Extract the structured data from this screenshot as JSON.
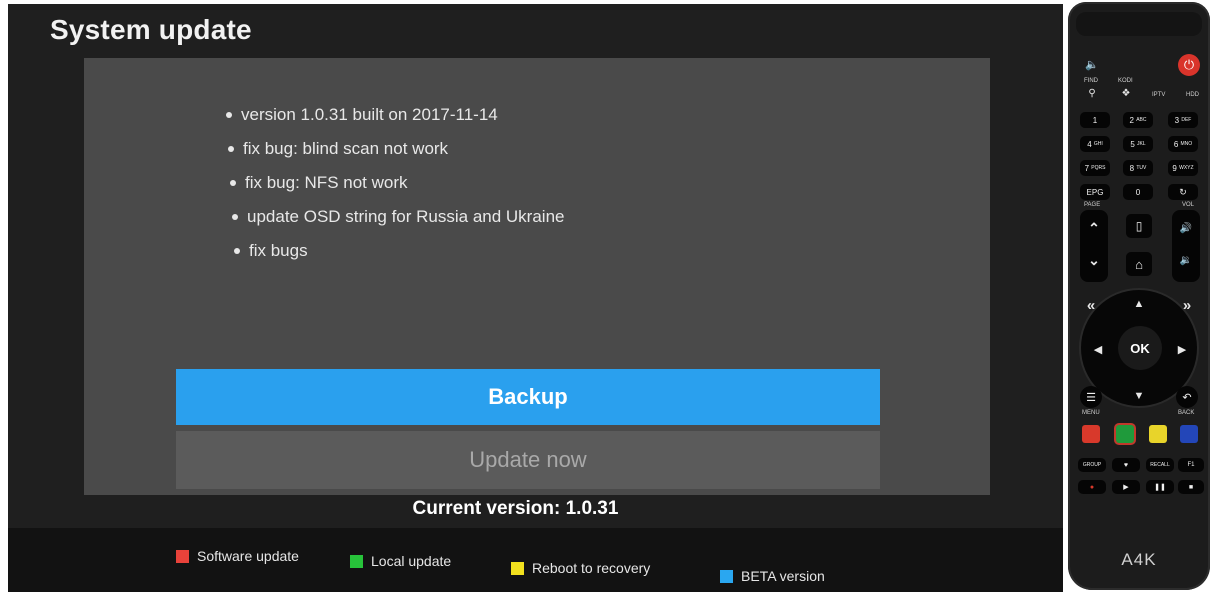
{
  "screen": {
    "title": "System update",
    "release_notes": [
      "version 1.0.31 built on 2017-11-14",
      "fix bug: blind scan not work",
      "fix bug: NFS not work",
      "update OSD string for Russia and Ukraine",
      "fix bugs"
    ],
    "buttons": {
      "backup": "Backup",
      "update_now": "Update now"
    },
    "current_version": "Current version: 1.0.31",
    "legend": [
      {
        "label": "Software update",
        "color": "#e8423a"
      },
      {
        "label": "Local update",
        "color": "#27c33a"
      },
      {
        "label": "Reboot to recovery",
        "color": "#f2e01e"
      },
      {
        "label": "BETA version",
        "color": "#2aa7f0"
      }
    ],
    "colors": {
      "focus_accent": "#2aa0ee",
      "panel": "#4a4a4a",
      "background": "#1f1f1f"
    }
  },
  "remote": {
    "labels": {
      "find": "FIND",
      "kodi": "KODI",
      "iptv": "IPTV",
      "hdd": "HDD",
      "page": "PAGE",
      "vol": "VOL",
      "menu": "MENU",
      "back": "BACK",
      "ok": "OK",
      "epg": "EPG",
      "group": "GROUP",
      "recall": "RECALL",
      "f1": "F1",
      "brand": "A4K"
    },
    "number_keys": [
      "1",
      "2",
      "3",
      "4",
      "5",
      "6",
      "7",
      "8",
      "9",
      "0"
    ],
    "number_key_letters": [
      "",
      "ABC",
      "DEF",
      "GHI",
      "JKL",
      "MNO",
      "PQRS",
      "TUV",
      "WXYZ",
      ""
    ],
    "color_keys": [
      "#d8392b",
      "#1f9a3b",
      "#e8d42a",
      "#2346b8"
    ]
  }
}
